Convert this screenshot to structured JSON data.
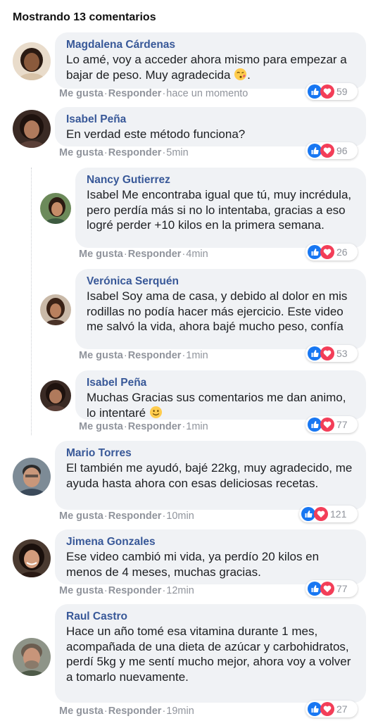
{
  "header": {
    "title": "Mostrando 13 comentarios"
  },
  "actions": {
    "like": "Me gusta",
    "reply": "Responder",
    "separator": "·"
  },
  "colors": {
    "name": "#385898",
    "like_blue": "#1877f2",
    "love_red": "#f33e58",
    "bubble": "#f0f2f5"
  },
  "comments": [
    {
      "name": "Magdalena Cárdenas",
      "text": "Lo amé, voy a acceder ahora mismo para empezar a bajar de peso. Muy agradecida",
      "emoji": "kiss-emoji",
      "text_end": ".",
      "time": "hace un momento",
      "reactions": "59"
    },
    {
      "name": "Isabel Peña",
      "text": "En verdad este método funciona?",
      "time": "5min",
      "reactions": "96"
    },
    {
      "name": "Nancy Gutierrez",
      "text": "Isabel Me encontraba igual que tú, muy incrédula, pero perdía más si no lo intentaba, gracias a eso logré perder +10 kilos en la primera semana.",
      "time": "4min",
      "reactions": "26"
    },
    {
      "name": "Verónica Serquén",
      "text": "Isabel Soy ama de casa, y debido al dolor en mis rodillas no podía hacer más ejercicio. Este video me salvó la vida, ahora bajé mucho peso, confía",
      "time": "1min",
      "reactions": "53"
    },
    {
      "name": "Isabel Peña",
      "text": "Muchas Gracias sus comentarios me dan animo, lo intentaré",
      "emoji": "smile-emoji",
      "time": "1min",
      "reactions": "77"
    },
    {
      "name": "Mario Torres",
      "text": "El también me ayudó, bajé 22kg, muy agradecido, me ayuda hasta ahora con esas deliciosas recetas.",
      "time": "10min",
      "reactions": "121"
    },
    {
      "name": "Jimena Gonzales",
      "text": "Ese video cambió mi vida, ya perdío 20 kilos en menos de 4 meses, muchas gracias.",
      "time": "12min",
      "reactions": "77"
    },
    {
      "name": "Raul Castro",
      "text": "Hace un año tomé esa vitamina durante 1 mes, acompañada de una dieta de azúcar y carbohidratos, perdí 5kg y me sentí mucho mejor, ahora voy a volver a tomarlo nuevamente.",
      "time": "19min",
      "reactions": "27"
    }
  ]
}
